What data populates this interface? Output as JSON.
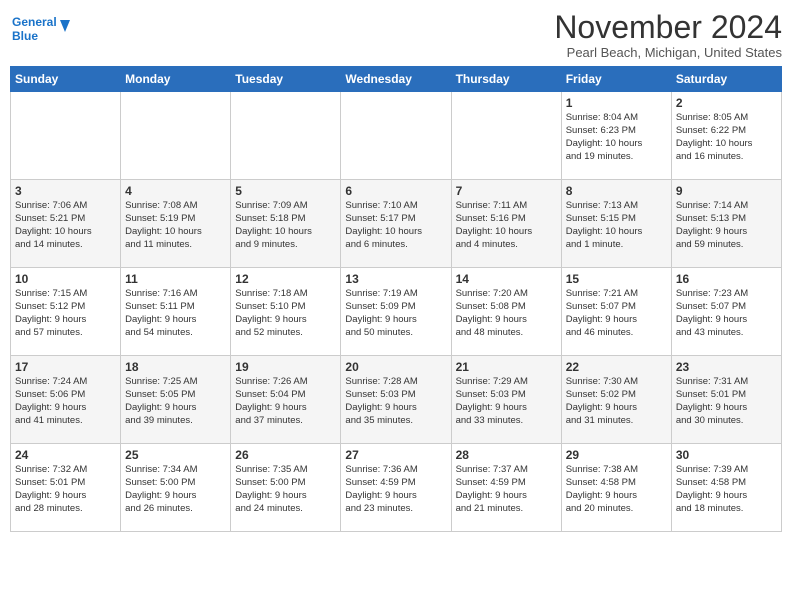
{
  "header": {
    "logo_line1": "General",
    "logo_line2": "Blue",
    "month": "November 2024",
    "location": "Pearl Beach, Michigan, United States"
  },
  "weekdays": [
    "Sunday",
    "Monday",
    "Tuesday",
    "Wednesday",
    "Thursday",
    "Friday",
    "Saturday"
  ],
  "weeks": [
    [
      {
        "day": "",
        "info": ""
      },
      {
        "day": "",
        "info": ""
      },
      {
        "day": "",
        "info": ""
      },
      {
        "day": "",
        "info": ""
      },
      {
        "day": "",
        "info": ""
      },
      {
        "day": "1",
        "info": "Sunrise: 8:04 AM\nSunset: 6:23 PM\nDaylight: 10 hours\nand 19 minutes."
      },
      {
        "day": "2",
        "info": "Sunrise: 8:05 AM\nSunset: 6:22 PM\nDaylight: 10 hours\nand 16 minutes."
      }
    ],
    [
      {
        "day": "3",
        "info": "Sunrise: 7:06 AM\nSunset: 5:21 PM\nDaylight: 10 hours\nand 14 minutes."
      },
      {
        "day": "4",
        "info": "Sunrise: 7:08 AM\nSunset: 5:19 PM\nDaylight: 10 hours\nand 11 minutes."
      },
      {
        "day": "5",
        "info": "Sunrise: 7:09 AM\nSunset: 5:18 PM\nDaylight: 10 hours\nand 9 minutes."
      },
      {
        "day": "6",
        "info": "Sunrise: 7:10 AM\nSunset: 5:17 PM\nDaylight: 10 hours\nand 6 minutes."
      },
      {
        "day": "7",
        "info": "Sunrise: 7:11 AM\nSunset: 5:16 PM\nDaylight: 10 hours\nand 4 minutes."
      },
      {
        "day": "8",
        "info": "Sunrise: 7:13 AM\nSunset: 5:15 PM\nDaylight: 10 hours\nand 1 minute."
      },
      {
        "day": "9",
        "info": "Sunrise: 7:14 AM\nSunset: 5:13 PM\nDaylight: 9 hours\nand 59 minutes."
      }
    ],
    [
      {
        "day": "10",
        "info": "Sunrise: 7:15 AM\nSunset: 5:12 PM\nDaylight: 9 hours\nand 57 minutes."
      },
      {
        "day": "11",
        "info": "Sunrise: 7:16 AM\nSunset: 5:11 PM\nDaylight: 9 hours\nand 54 minutes."
      },
      {
        "day": "12",
        "info": "Sunrise: 7:18 AM\nSunset: 5:10 PM\nDaylight: 9 hours\nand 52 minutes."
      },
      {
        "day": "13",
        "info": "Sunrise: 7:19 AM\nSunset: 5:09 PM\nDaylight: 9 hours\nand 50 minutes."
      },
      {
        "day": "14",
        "info": "Sunrise: 7:20 AM\nSunset: 5:08 PM\nDaylight: 9 hours\nand 48 minutes."
      },
      {
        "day": "15",
        "info": "Sunrise: 7:21 AM\nSunset: 5:07 PM\nDaylight: 9 hours\nand 46 minutes."
      },
      {
        "day": "16",
        "info": "Sunrise: 7:23 AM\nSunset: 5:07 PM\nDaylight: 9 hours\nand 43 minutes."
      }
    ],
    [
      {
        "day": "17",
        "info": "Sunrise: 7:24 AM\nSunset: 5:06 PM\nDaylight: 9 hours\nand 41 minutes."
      },
      {
        "day": "18",
        "info": "Sunrise: 7:25 AM\nSunset: 5:05 PM\nDaylight: 9 hours\nand 39 minutes."
      },
      {
        "day": "19",
        "info": "Sunrise: 7:26 AM\nSunset: 5:04 PM\nDaylight: 9 hours\nand 37 minutes."
      },
      {
        "day": "20",
        "info": "Sunrise: 7:28 AM\nSunset: 5:03 PM\nDaylight: 9 hours\nand 35 minutes."
      },
      {
        "day": "21",
        "info": "Sunrise: 7:29 AM\nSunset: 5:03 PM\nDaylight: 9 hours\nand 33 minutes."
      },
      {
        "day": "22",
        "info": "Sunrise: 7:30 AM\nSunset: 5:02 PM\nDaylight: 9 hours\nand 31 minutes."
      },
      {
        "day": "23",
        "info": "Sunrise: 7:31 AM\nSunset: 5:01 PM\nDaylight: 9 hours\nand 30 minutes."
      }
    ],
    [
      {
        "day": "24",
        "info": "Sunrise: 7:32 AM\nSunset: 5:01 PM\nDaylight: 9 hours\nand 28 minutes."
      },
      {
        "day": "25",
        "info": "Sunrise: 7:34 AM\nSunset: 5:00 PM\nDaylight: 9 hours\nand 26 minutes."
      },
      {
        "day": "26",
        "info": "Sunrise: 7:35 AM\nSunset: 5:00 PM\nDaylight: 9 hours\nand 24 minutes."
      },
      {
        "day": "27",
        "info": "Sunrise: 7:36 AM\nSunset: 4:59 PM\nDaylight: 9 hours\nand 23 minutes."
      },
      {
        "day": "28",
        "info": "Sunrise: 7:37 AM\nSunset: 4:59 PM\nDaylight: 9 hours\nand 21 minutes."
      },
      {
        "day": "29",
        "info": "Sunrise: 7:38 AM\nSunset: 4:58 PM\nDaylight: 9 hours\nand 20 minutes."
      },
      {
        "day": "30",
        "info": "Sunrise: 7:39 AM\nSunset: 4:58 PM\nDaylight: 9 hours\nand 18 minutes."
      }
    ]
  ]
}
